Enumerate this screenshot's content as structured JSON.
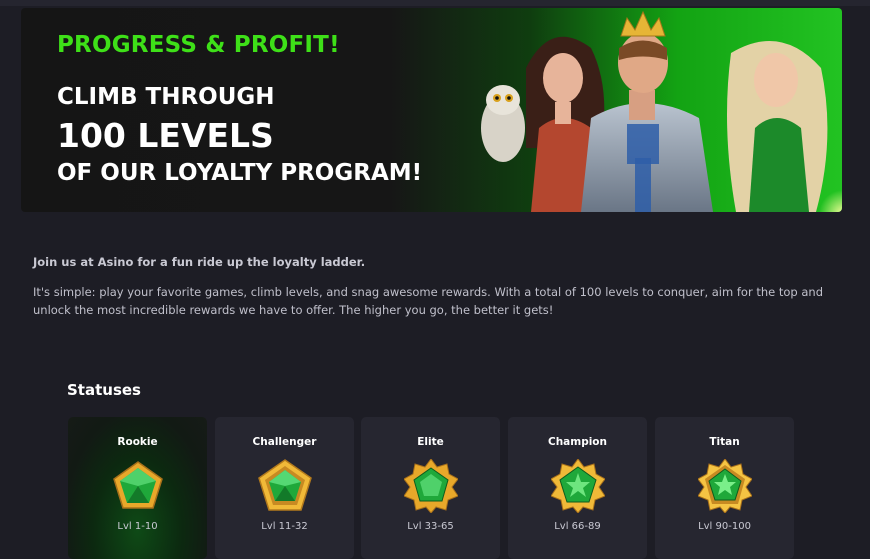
{
  "banner": {
    "title": "PROGRESS & PROFIT!",
    "line1": "CLIMB THROUGH",
    "line2": "100 LEVELS",
    "line3": "OF OUR LOYALTY PROGRAM!"
  },
  "intro": {
    "bold": "Join us at Asino for a fun ride up the loyalty ladder.",
    "text": "It's simple: play your favorite games, climb levels, and snag awesome rewards. With a total of 100 levels to conquer, aim for the top and unlock the most incredible rewards we have to offer. The higher you go, the better it gets!"
  },
  "statuses": {
    "heading": "Statuses",
    "items": [
      {
        "name": "Rookie",
        "levels": "Lvl 1-10",
        "icon": "pentagon-gem-icon"
      },
      {
        "name": "Challenger",
        "levels": "Lvl 11-32",
        "icon": "pentagon-gem-badge-icon"
      },
      {
        "name": "Elite",
        "levels": "Lvl 33-65",
        "icon": "spiked-gem-badge-icon"
      },
      {
        "name": "Champion",
        "levels": "Lvl 66-89",
        "icon": "star-gem-badge-icon"
      },
      {
        "name": "Titan",
        "levels": "Lvl 90-100",
        "icon": "crown-gem-badge-icon"
      }
    ]
  },
  "colors": {
    "background": "#1d1d25",
    "card": "#262630",
    "accent_green": "#3ee018",
    "gold": "#e8a82a",
    "gem_green": "#1fa83a"
  }
}
